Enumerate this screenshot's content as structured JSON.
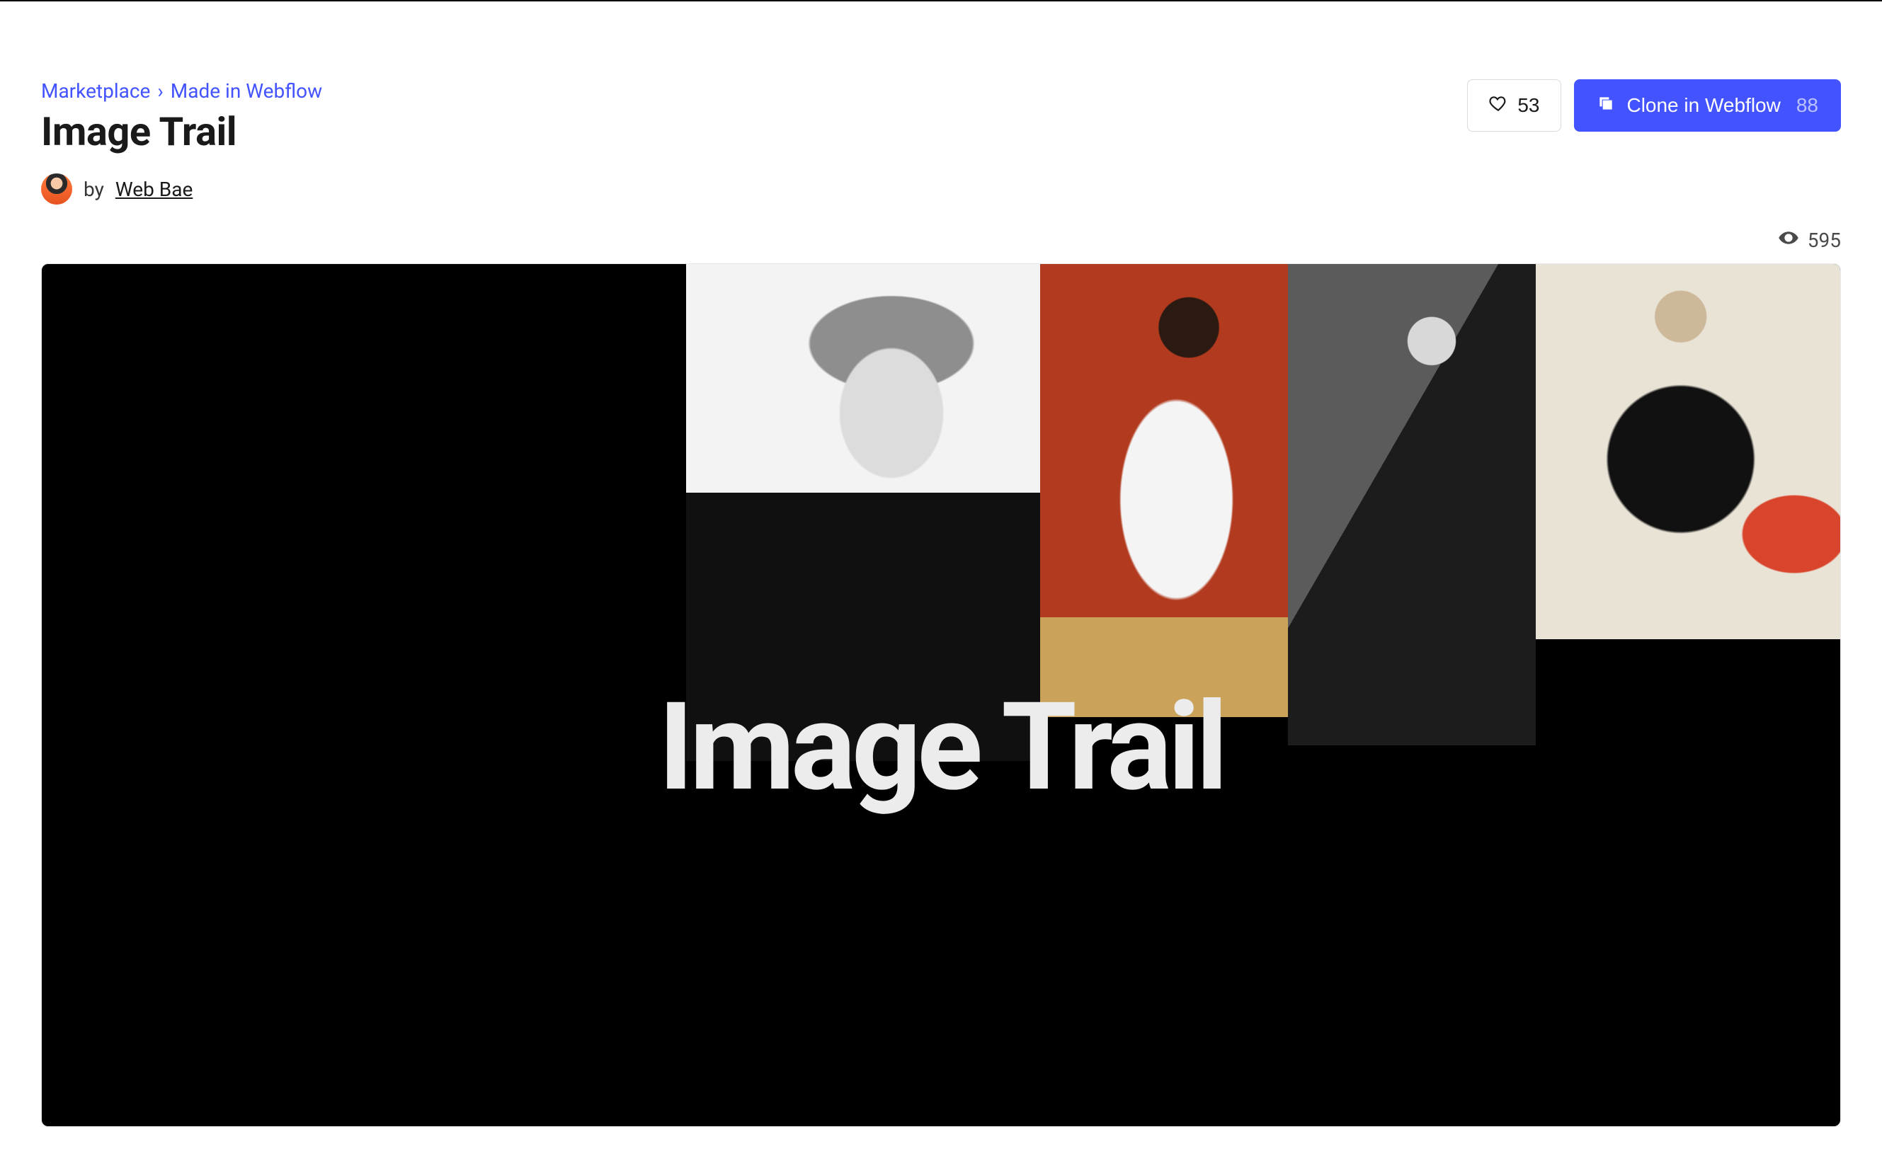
{
  "breadcrumb": {
    "marketplace": "Marketplace",
    "separator": "›",
    "madeIn": "Made in Webflow"
  },
  "title": "Image Trail",
  "byline": {
    "prefix": "by",
    "author": "Web Bae"
  },
  "actions": {
    "likeCount": "53",
    "cloneLabel": "Clone in Webflow",
    "cloneCount": "88"
  },
  "stats": {
    "views": "595"
  },
  "hero": {
    "overlayTitle": "Image Trail"
  }
}
